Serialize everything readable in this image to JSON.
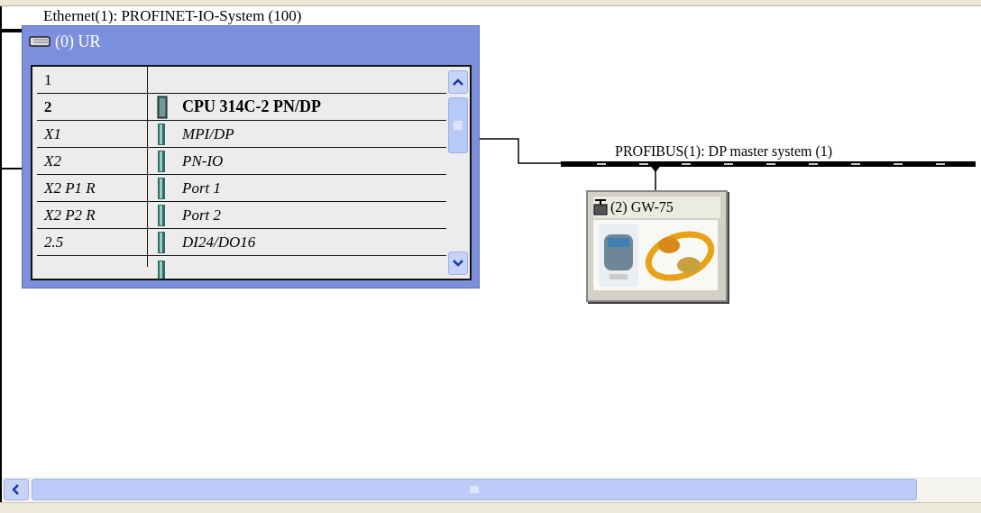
{
  "networks": [
    {
      "kind": "ethernet",
      "label": "Ethernet(1): PROFINET-IO-System (100)"
    },
    {
      "kind": "profibus",
      "label": "PROFIBUS(1): DP master system (1)"
    }
  ],
  "rack": {
    "title": "(0) UR",
    "rows": [
      {
        "kind": "slot",
        "slot": "1"
      },
      {
        "kind": "cpu",
        "slot": "2",
        "module": "CPU 314C-2 PN/DP"
      },
      {
        "kind": "sub",
        "slot": "X1",
        "module": "MPI/DP"
      },
      {
        "kind": "sub",
        "slot": "X2",
        "module": "PN-IO"
      },
      {
        "kind": "sub",
        "slot": "X2 P1 R",
        "module": "Port 1"
      },
      {
        "kind": "sub",
        "slot": "X2 P2 R",
        "module": "Port 2"
      },
      {
        "kind": "sub",
        "slot": "2.5",
        "module": "DI24/DO16"
      },
      {
        "kind": "cut"
      }
    ]
  },
  "dp_slave": {
    "title": "(2) GW-75"
  }
}
